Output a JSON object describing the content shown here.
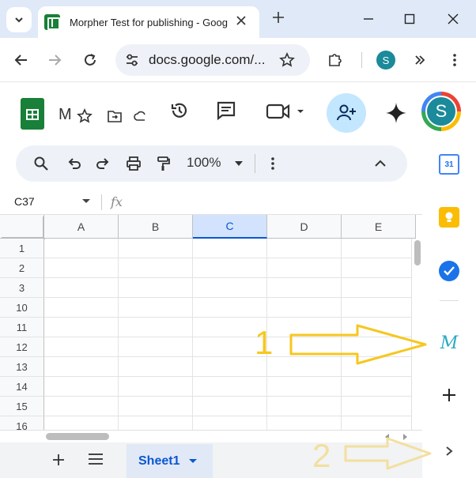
{
  "browser": {
    "tab_title": "Morpher Test for publishing - Google",
    "url": "docs.google.com/...",
    "profile_initial": "S"
  },
  "docs": {
    "title_fragment": "M",
    "avatar_initial": "S"
  },
  "toolbar": {
    "zoom": "100%"
  },
  "formula": {
    "cell_ref": "C37",
    "fx_label": "fx"
  },
  "grid": {
    "columns": [
      "A",
      "B",
      "C",
      "D",
      "E"
    ],
    "selected_column": "C",
    "rows": [
      "1",
      "2",
      "3",
      "10",
      "11",
      "12",
      "13",
      "14",
      "15",
      "16"
    ]
  },
  "sheets": {
    "active_tab": "Sheet1"
  },
  "side_panel": {
    "calendar_day": "31",
    "morpher_glyph": "M"
  },
  "annotations": {
    "label_1": "1",
    "label_2": "2",
    "color": "#f6c71f"
  }
}
